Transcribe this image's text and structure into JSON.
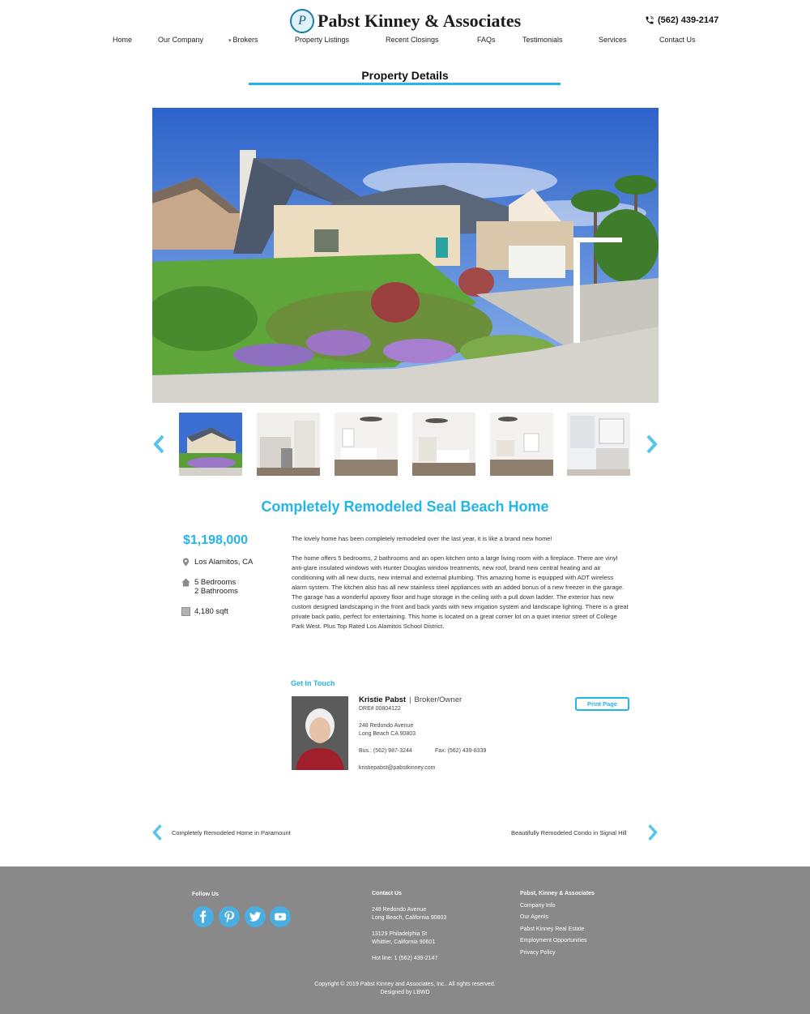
{
  "header": {
    "logo_initials": "P",
    "company_name": "Pabst Kinney & Associates",
    "phone": "(562) 439-2147"
  },
  "nav": {
    "items": [
      "Home",
      "Our Company",
      "Brokers",
      "Property Listings",
      "Recent Closings",
      "FAQs",
      "Testimonials",
      "Services",
      "Contact Us"
    ]
  },
  "page": {
    "section_title": "Property Details"
  },
  "listing": {
    "title": "Completely Remodeled Seal Beach Home",
    "price": "$1,198,000",
    "location": "Los Alamitos, CA",
    "bedrooms": "5 Bedrooms",
    "bathrooms": "2 Bathrooms",
    "sqft": "4,180 sqft",
    "description_1": "The lovely home has been completely remodeled over the last year, it is like a brand new home!",
    "description_2": "The home offers 5 bedrooms, 2 bathrooms and an open kitchen onto a large living room with a fireplace. There are vinyl anti-glare insulated windows with Hunter Douglas window treatments, new roof, brand new central heating and air conditioning with all new ducts, new internal and external plumbing. This amazing home is equipped with ADT wireless alarm system. The kitchen also has all new stainless steel appliances with an added bonus of a new freezer in the garage. The garage has a wonderful apoxey floor and huge storage in the ceiling with a pull down ladder. The exterior has new custom designed landscaping in the front and back yards with new irrigation system and landscape lighting. There is a great private back patio, perfect for entertaining. This home is located on a great corner lot on a quiet interior street of College Park West. Plus Top Rated Los Alamitos School District."
  },
  "contact": {
    "heading": "Get In Touch",
    "agent_name": "Kristie Pabst",
    "separator": "|",
    "agent_role": "Broker/Owner",
    "dre": "DRE# 00804122",
    "address_1": "248 Redondo Avenue",
    "address_2": "Long Beach CA 90803",
    "bus": "Bus.: (562) 987-3244",
    "fax": "Fax: (562) 439-8339",
    "email": "kristiepabst@pabstkinney.com",
    "print_label": "Print Page"
  },
  "pager": {
    "prev_label": "Completely Remodeled Home in Paramount",
    "next_label": "Beautifully Remodeled Condo in Signal Hill"
  },
  "footer": {
    "follow_heading": "Follow Us",
    "contact_heading": "Contact Us",
    "contact_lines": [
      "248 Redondo Avenue",
      "Long Beach, California 90803",
      "13129 Philadelphia St",
      "Whittier, California 90601",
      "Hot line: 1 (562) 439-2147"
    ],
    "company_heading": "Pabst, Kinney & Associates",
    "company_links": [
      "Company Info",
      "Our Agents",
      "Pabst Kinney Real Estate",
      "Employment Opportunities",
      "Privacy Policy"
    ],
    "copyright": "Copyright © 2019 Pabst Kinney and Associates, Inc.. All rights reserved.",
    "designer": "Designed by LBWD",
    "social_icons": [
      "facebook-icon",
      "pinterest-icon",
      "twitter-icon",
      "youtube-icon"
    ]
  },
  "colors": {
    "accent": "#23b5e8",
    "footer_bg": "#898989",
    "social_bg": "#4aaee0"
  }
}
